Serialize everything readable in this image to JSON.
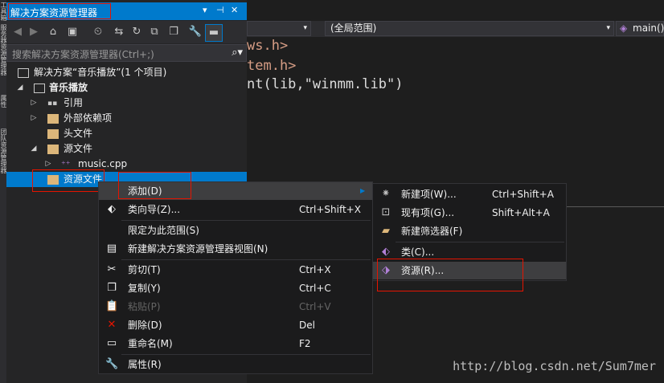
{
  "vstrip": {
    "labels": [
      "工具箱",
      "服务器资源管理器",
      "属性",
      "团队资源管理器"
    ]
  },
  "panel": {
    "title": "解决方案资源管理器",
    "title_controls": [
      "▾",
      "⊣",
      "✕"
    ],
    "search_placeholder": "搜索解决方案资源管理器(Ctrl+;)"
  },
  "tree": {
    "solution": "解决方案“音乐播放”(1 个项目)",
    "project": "音乐播放",
    "references": "引用",
    "external": "外部依赖项",
    "headers": "头文件",
    "sources": "源文件",
    "music_cpp": "music.cpp",
    "resources": "资源文件"
  },
  "editor": {
    "scope": "(全局范围)",
    "function": "main()",
    "code_lines": [
      "ws.h>",
      "tem.h>",
      "nt(lib,\"winmm.lib\")"
    ]
  },
  "context_menu": {
    "add": "添加(D)",
    "class_wizard": "类向导(Z)...",
    "class_wizard_key": "Ctrl+Shift+X",
    "scope_to_this": "限定为此范围(S)",
    "new_view": "新建解决方案资源管理器视图(N)",
    "cut": "剪切(T)",
    "cut_key": "Ctrl+X",
    "copy": "复制(Y)",
    "copy_key": "Ctrl+C",
    "paste": "粘贴(P)",
    "paste_key": "Ctrl+V",
    "delete": "删除(D)",
    "delete_key": "Del",
    "rename": "重命名(M)",
    "rename_key": "F2",
    "properties": "属性(R)"
  },
  "submenu": {
    "new_item": "新建项(W)...",
    "new_item_key": "Ctrl+Shift+A",
    "existing_item": "现有项(G)...",
    "existing_item_key": "Shift+Alt+A",
    "new_filter": "新建筛选器(F)",
    "class": "类(C)...",
    "resource": "资源(R)..."
  },
  "watermark": "http://blog.csdn.net/Sum7mer",
  "colors": {
    "accent": "#007acc",
    "highlight_red": "#e51400",
    "code_yellow": "#d69d85"
  }
}
